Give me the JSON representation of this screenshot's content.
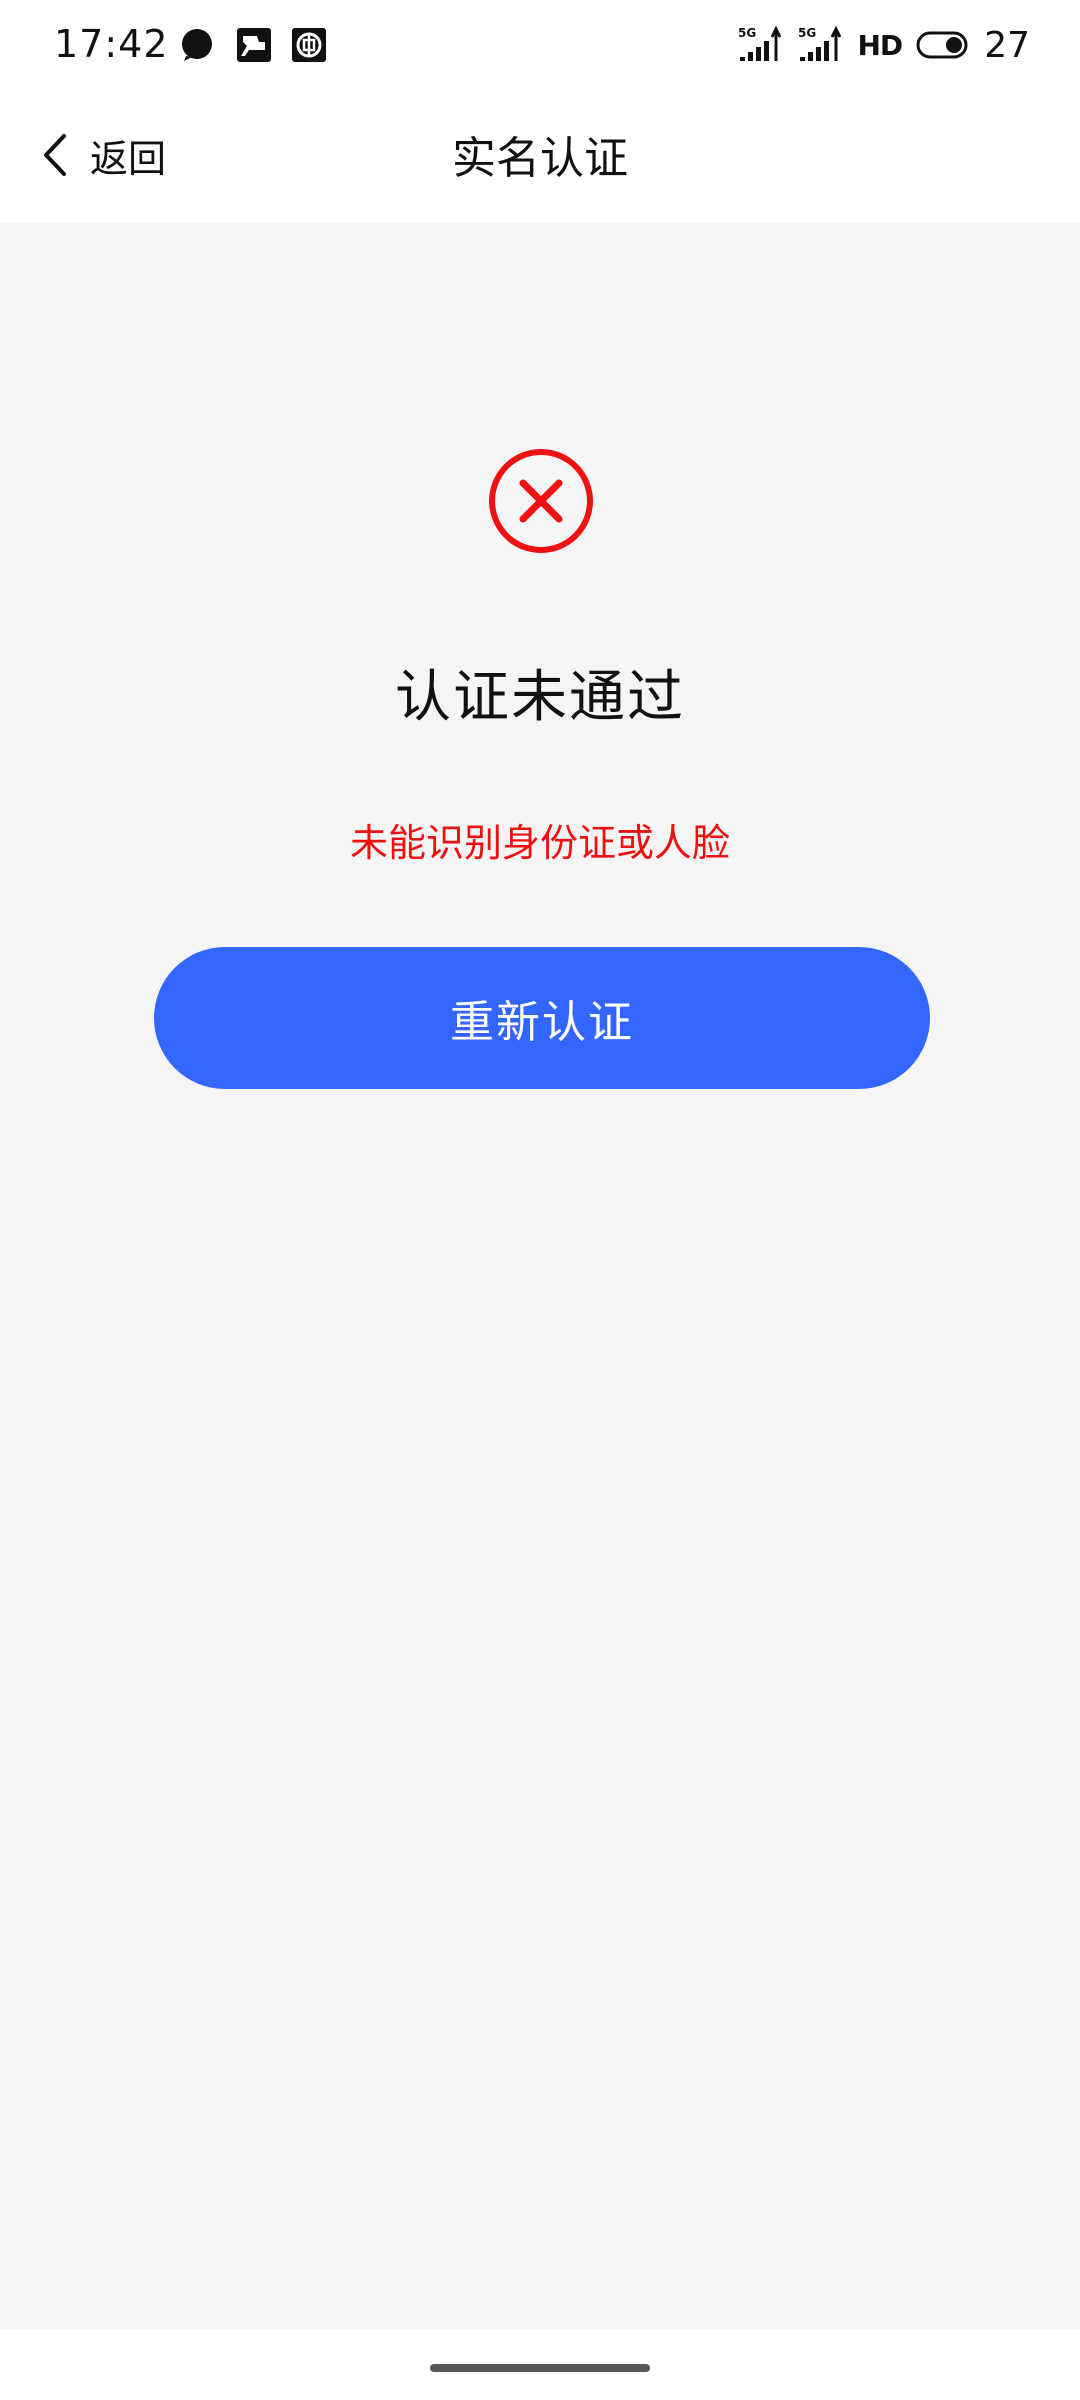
{
  "status_bar": {
    "time": "17:42",
    "network_label": "5G",
    "hd_label": "HD",
    "battery": "27",
    "icons": [
      "chat-bubble-icon",
      "train-app-icon",
      "bank-app-icon",
      "signal-5g-icon",
      "signal-5g-icon",
      "hd-voice-icon",
      "battery-icon"
    ]
  },
  "nav": {
    "back_label": "返回",
    "title": "实名认证"
  },
  "result": {
    "status_icon": "error-circle-icon",
    "title": "认证未通过",
    "reason": "未能识别身份证或人脸",
    "retry_label": "重新认证"
  },
  "colors": {
    "accent": "#3366ff",
    "error": "#ee1111",
    "background": "#f5f5f5"
  }
}
